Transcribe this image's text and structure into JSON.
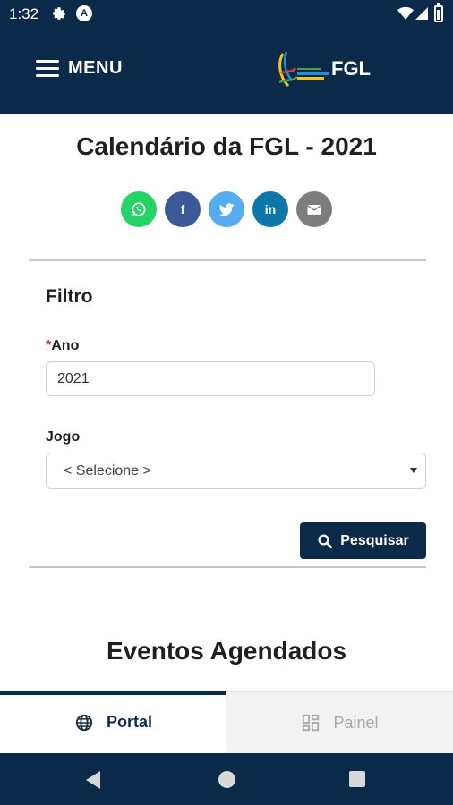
{
  "status_bar": {
    "time": "1:32",
    "icons": [
      "gear-icon",
      "a-badge-icon",
      "wifi-icon",
      "signal-icon",
      "battery-icon"
    ]
  },
  "header": {
    "menu_label": "MENU",
    "brand_text": "FGL",
    "brand_color": "#0b2a4a"
  },
  "page": {
    "title": "Calendário da FGL - 2021"
  },
  "share": {
    "buttons": [
      {
        "name": "whatsapp",
        "color": "#25d366",
        "icon": "whatsapp-icon"
      },
      {
        "name": "facebook",
        "color": "#3b5998",
        "icon": "facebook-icon"
      },
      {
        "name": "twitter",
        "color": "#55acee",
        "icon": "twitter-icon"
      },
      {
        "name": "linkedin",
        "color": "#0e76a8",
        "icon": "linkedin-icon"
      },
      {
        "name": "email",
        "color": "#7d7d7d",
        "icon": "email-icon"
      }
    ],
    "facebook_glyph": "f",
    "linkedin_glyph": "in"
  },
  "filter": {
    "title": "Filtro",
    "ano": {
      "required_mark": "*",
      "label": "Ano",
      "value": "2021"
    },
    "jogo": {
      "label": "Jogo",
      "selected": "< Selecione >"
    },
    "search_label": "Pesquisar"
  },
  "events": {
    "title": "Eventos Agendados"
  },
  "tabs": [
    {
      "label": "Portal",
      "icon": "globe-icon",
      "active": true
    },
    {
      "label": "Painel",
      "icon": "dashboard-grid-icon",
      "active": false
    }
  ],
  "nav": {
    "buttons": [
      "back-icon",
      "home-icon",
      "recents-icon"
    ]
  }
}
